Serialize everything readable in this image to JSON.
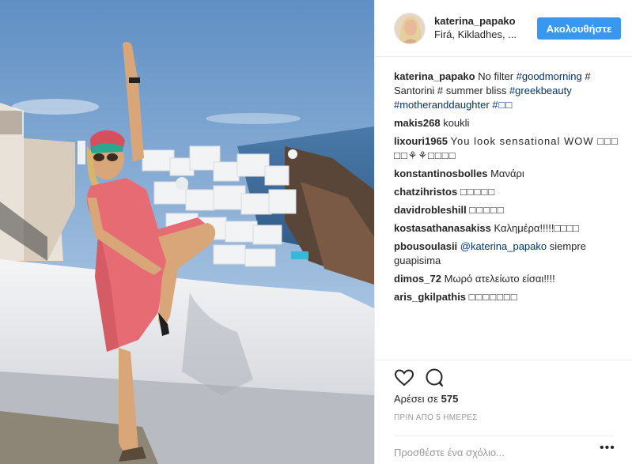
{
  "header": {
    "username": "katerina_papako",
    "location": "Firá, Kikladhes, ...",
    "follow_label": "Ακολουθήστε"
  },
  "caption": {
    "user": "katerina_papako",
    "parts": [
      "No filter ",
      "#goodmorning",
      " # Santorini # summer bliss ",
      "#greekbeauty",
      " ",
      "#motheranddaughter",
      " ",
      "#□□"
    ]
  },
  "comments": [
    {
      "user": "makis268",
      "text": "koukli"
    },
    {
      "user": "lixouri1965",
      "text": "You look sensational WOW □□□ □□⚘⚘□□□□"
    },
    {
      "user": "konstantinosbolles",
      "text": "Μανάρι"
    },
    {
      "user": "chatzihristos",
      "text": "□□□□□"
    },
    {
      "user": "davidrobleshill",
      "text": "□□□□□"
    },
    {
      "user": "kostasathanasakiss",
      "text": "Καλημέρα!!!!!□□□□"
    },
    {
      "user": "pbousoulasii",
      "mention": "@katerina_papako",
      "text": " siempre guapisima"
    },
    {
      "user": "dimos_72",
      "text": "Μωρό ατελείωτο είσαι!!!!"
    },
    {
      "user": "aris_gkilpathis",
      "text": "□□□□□□□"
    }
  ],
  "actions": {
    "like_icon": "heart-icon",
    "comment_icon": "speech-bubble-icon"
  },
  "likes": {
    "label": "Αρέσει σε",
    "count": "575"
  },
  "timestamp": "ΠΡΙΝ ΑΠΟ 5 ΗΜΕΡΕΣ",
  "add_comment": {
    "placeholder": "Προσθέστε ένα σχόλιο...",
    "more_label": "•••"
  },
  "colors": {
    "accent": "#3897f0",
    "hashtag": "#003569",
    "muted": "#999999"
  }
}
